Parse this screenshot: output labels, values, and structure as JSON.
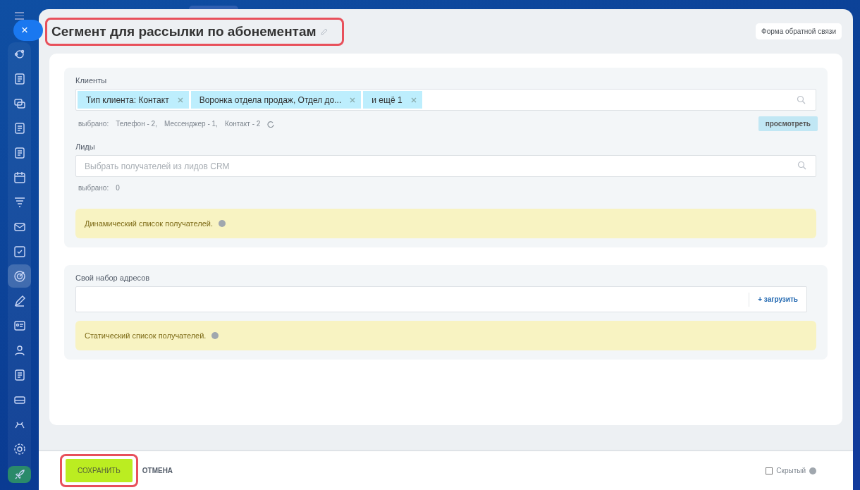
{
  "sidebar": {
    "items": [
      {
        "selected": false
      },
      {
        "selected": false
      },
      {
        "selected": false
      },
      {
        "selected": false
      },
      {
        "selected": false
      },
      {
        "selected": false
      },
      {
        "selected": false
      },
      {
        "selected": false
      },
      {
        "selected": false
      },
      {
        "selected": true
      },
      {
        "selected": false
      },
      {
        "selected": false
      },
      {
        "selected": false
      },
      {
        "selected": false
      },
      {
        "selected": false
      },
      {
        "selected": false
      },
      {
        "selected": false
      },
      {
        "selected": false
      }
    ]
  },
  "close_button": "×",
  "title": {
    "text": "Сегмент для рассылки по абонементам",
    "highlighted": true
  },
  "feedback_button": "Форма обратной связи",
  "clients": {
    "label": "Клиенты",
    "tags": [
      {
        "text": "Тип клиента: Контакт"
      },
      {
        "text": "Воронка отдела продаж, Отдел до..."
      },
      {
        "text": "и ещё 1"
      }
    ],
    "selected_label": "выбрано:",
    "counts": [
      "Телефон - 2,",
      "Мессенджер - 1,",
      "Контакт - 2"
    ],
    "view_button": "просмотреть"
  },
  "leads": {
    "label": "Лиды",
    "placeholder": "Выбрать получателей из лидов CRM",
    "selected_label": "выбрано:",
    "count": "0",
    "notice": "Динамический список получателей."
  },
  "addresses": {
    "label": "Свой набор адресов",
    "upload_button": "+ загрузить",
    "notice": "Статический список получателей."
  },
  "footer": {
    "save_button": {
      "text": "СОХРАНИТЬ",
      "highlighted": true
    },
    "cancel_button": "ОТМЕНА",
    "hidden_checkbox": {
      "label": "Скрытый",
      "checked": false
    }
  }
}
